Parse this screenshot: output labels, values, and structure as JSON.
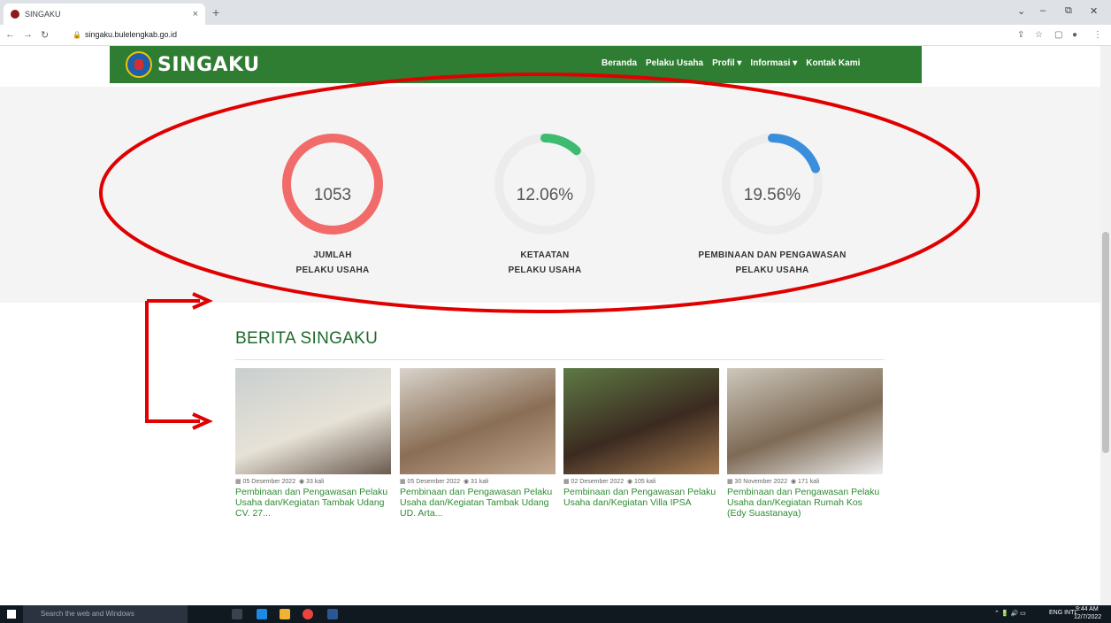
{
  "browser": {
    "tab_title": "SINGAKU",
    "tab_close": "×",
    "new_tab": "+",
    "url": "singaku.bulelengkab.go.id",
    "window_controls": [
      "⌄",
      "–",
      "⧉",
      "✕"
    ]
  },
  "site": {
    "logo_text": "SINGAKU",
    "menu": [
      "Beranda",
      "Pelaku Usaha",
      "Profil ▾",
      "Informasi ▾",
      "Kontak Kami"
    ]
  },
  "stats": [
    {
      "value": "1053",
      "label_line1": "JUMLAH",
      "label_line2": "PELAKU USAHA",
      "progress": 1.0,
      "color": "#f26b6b"
    },
    {
      "value": "12.06%",
      "label_line1": "KETAATAN",
      "label_line2": "PELAKU USAHA",
      "progress": 0.1206,
      "color": "#3dbb6f"
    },
    {
      "value": "19.56%",
      "label_line1": "PEMBINAAN DAN PENGAWASAN",
      "label_line2": "PELAKU USAHA",
      "progress": 0.1956,
      "color": "#3a8fdc"
    }
  ],
  "news": {
    "title": "BERITA SINGAKU",
    "items": [
      {
        "date": "▦ 05 Desember 2022",
        "views": "◉ 33 kali",
        "title": "Pembinaan dan Pengawasan Pelaku Usaha dan/Kegiatan Tambak Udang CV. 27...",
        "palette": [
          "#c9cfcf",
          "#e7e2d7",
          "#6b5b4f"
        ]
      },
      {
        "date": "▦ 05 Desember 2022",
        "views": "◉ 31 kali",
        "title": "Pembinaan dan Pengawasan Pelaku Usaha dan/Kegiatan Tambak Udang UD. Arta...",
        "palette": [
          "#d9d4cc",
          "#8a6e55",
          "#c2a88e"
        ]
      },
      {
        "date": "▦ 02 Desember 2022",
        "views": "◉ 105 kali",
        "title": "Pembinaan dan Pengawasan Pelaku Usaha dan/Kegiatan Villa IPSA",
        "palette": [
          "#5e7a45",
          "#3b2a20",
          "#a47b52"
        ]
      },
      {
        "date": "▦ 30 November 2022",
        "views": "◉ 171 kali",
        "title": "Pembinaan dan Pengawasan Pelaku Usaha dan/Kegiatan Rumah Kos (Edy Suastanaya)",
        "palette": [
          "#cdc8bc",
          "#7e6a55",
          "#ededed"
        ]
      }
    ]
  },
  "taskbar": {
    "search_placeholder": "Search the web and Windows",
    "lang": "ENG INTL",
    "time": "9:44 AM",
    "date": "12/7/2022"
  },
  "colors": {
    "nav_green": "#2e8b32",
    "heading_green": "#1d6b2a",
    "annotation_red": "#e00000"
  }
}
